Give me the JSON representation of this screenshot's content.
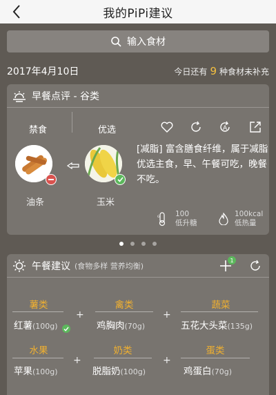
{
  "nav": {
    "title": "我的PiPi建议",
    "back_icon": "chevron-left-icon"
  },
  "search": {
    "placeholder": "输入食材"
  },
  "date": "2017年4月10日",
  "status": {
    "prefix": "今日还有",
    "count": "9",
    "suffix": "种食材未补充"
  },
  "breakfast": {
    "title": "早餐点评 - 谷类",
    "avoid_label": "禁食",
    "prefer_label": "优选",
    "avoid_food": "油条",
    "prefer_food": "玉米",
    "description": "[减脂] 富含膳食纤维，属于减脂优选主食，早、午餐可吃，晚餐不吃。",
    "metrics": [
      {
        "value": "100",
        "label": "低升糖",
        "icon": "gi-thermometer-icon"
      },
      {
        "value": "100kcal",
        "label": "低热量",
        "icon": "flame-icon"
      }
    ]
  },
  "pager": {
    "count": 4,
    "active": 0
  },
  "lunch": {
    "title": "午餐建议",
    "subtitle": "(食物多样  营养均衡)",
    "add_badge": "1",
    "groups": [
      {
        "category": "薯类",
        "food": "红薯",
        "weight": "(100g)",
        "checked": true
      },
      {
        "category": "禽类",
        "food": "鸡胸肉",
        "weight": "(70g)"
      },
      {
        "category": "蔬菜",
        "food": "五花大头菜",
        "weight": "(135g)"
      },
      {
        "category": "水果",
        "food": "苹果",
        "weight": "(100g)"
      },
      {
        "category": "奶类",
        "food": "脱脂奶",
        "weight": "(100g)"
      },
      {
        "category": "蛋类",
        "food": "鸡蛋白",
        "weight": "(70g)"
      }
    ]
  },
  "colors": {
    "accent": "#f0b030",
    "check": "#5cb85c",
    "remove": "#d9534f"
  }
}
